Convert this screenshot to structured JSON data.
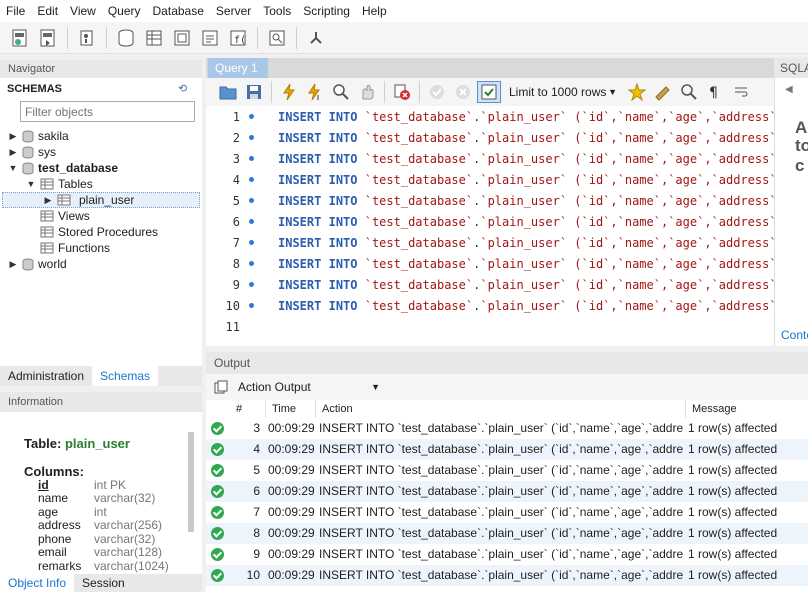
{
  "menu": [
    "File",
    "Edit",
    "View",
    "Query",
    "Database",
    "Server",
    "Tools",
    "Scripting",
    "Help"
  ],
  "navigator": {
    "title": "Navigator",
    "schemas_label": "SCHEMAS",
    "filter_placeholder": "Filter objects",
    "tree": {
      "sakila": "sakila",
      "sys": "sys",
      "test_database": "test_database",
      "tables": "Tables",
      "plain_user": "plain_user",
      "views": "Views",
      "stored_procedures": "Stored Procedures",
      "functions": "Functions",
      "world": "world"
    },
    "tabs": {
      "administration": "Administration",
      "schemas": "Schemas"
    }
  },
  "information": {
    "title": "Information",
    "table_prefix": "Table: ",
    "table_name": "plain_user",
    "columns_label": "Columns:",
    "columns": [
      {
        "name": "id",
        "type": "int PK"
      },
      {
        "name": "name",
        "type": "varchar(32)"
      },
      {
        "name": "age",
        "type": "int"
      },
      {
        "name": "address",
        "type": "varchar(256)"
      },
      {
        "name": "phone",
        "type": "varchar(32)"
      },
      {
        "name": "email",
        "type": "varchar(128)"
      },
      {
        "name": "remarks",
        "type": "varchar(1024)"
      }
    ],
    "tabs": {
      "object_info": "Object Info",
      "session": "Session"
    }
  },
  "query": {
    "tab_label": "Query 1",
    "right_tab_label": "SQLA",
    "limit_label": "Limit to 1000 rows",
    "right_panel_lines": [
      "A",
      "to",
      "c"
    ],
    "right_panel_link": "Conte",
    "lines": [
      {
        "num": "1",
        "kw1": "INSERT",
        "kw2": "INTO",
        "db": "`test_database`",
        "dot": ".",
        "tbl": "`plain_user`",
        "cols": " (`id`,`name`,`age`,`address`,`"
      },
      {
        "num": "2",
        "kw1": "INSERT",
        "kw2": "INTO",
        "db": "`test_database`",
        "dot": ".",
        "tbl": "`plain_user`",
        "cols": " (`id`,`name`,`age`,`address`,`"
      },
      {
        "num": "3",
        "kw1": "INSERT",
        "kw2": "INTO",
        "db": "`test_database`",
        "dot": ".",
        "tbl": "`plain_user`",
        "cols": " (`id`,`name`,`age`,`address`,`"
      },
      {
        "num": "4",
        "kw1": "INSERT",
        "kw2": "INTO",
        "db": "`test_database`",
        "dot": ".",
        "tbl": "`plain_user`",
        "cols": " (`id`,`name`,`age`,`address`,`"
      },
      {
        "num": "5",
        "kw1": "INSERT",
        "kw2": "INTO",
        "db": "`test_database`",
        "dot": ".",
        "tbl": "`plain_user`",
        "cols": " (`id`,`name`,`age`,`address`,`"
      },
      {
        "num": "6",
        "kw1": "INSERT",
        "kw2": "INTO",
        "db": "`test_database`",
        "dot": ".",
        "tbl": "`plain_user`",
        "cols": " (`id`,`name`,`age`,`address`,`"
      },
      {
        "num": "7",
        "kw1": "INSERT",
        "kw2": "INTO",
        "db": "`test_database`",
        "dot": ".",
        "tbl": "`plain_user`",
        "cols": " (`id`,`name`,`age`,`address`,`"
      },
      {
        "num": "8",
        "kw1": "INSERT",
        "kw2": "INTO",
        "db": "`test_database`",
        "dot": ".",
        "tbl": "`plain_user`",
        "cols": " (`id`,`name`,`age`,`address`,`"
      },
      {
        "num": "9",
        "kw1": "INSERT",
        "kw2": "INTO",
        "db": "`test_database`",
        "dot": ".",
        "tbl": "`plain_user`",
        "cols": " (`id`,`name`,`age`,`address`,`"
      },
      {
        "num": "10",
        "kw1": "INSERT",
        "kw2": "INTO",
        "db": "`test_database`",
        "dot": ".",
        "tbl": "`plain_user`",
        "cols": " (`id`,`name`,`age`,`address`,`"
      }
    ],
    "last_line_num": "11"
  },
  "output": {
    "title": "Output",
    "selector": "Action Output",
    "headers": {
      "num": "#",
      "time": "Time",
      "action": "Action",
      "message": "Message"
    },
    "rows": [
      {
        "num": "3",
        "time": "00:09:29",
        "action": "INSERT INTO `test_database`.`plain_user` (`id`,`name`,`age`,`address`,`ph...",
        "message": "1 row(s) affected"
      },
      {
        "num": "4",
        "time": "00:09:29",
        "action": "INSERT INTO `test_database`.`plain_user` (`id`,`name`,`age`,`address`,`ph...",
        "message": "1 row(s) affected"
      },
      {
        "num": "5",
        "time": "00:09:29",
        "action": "INSERT INTO `test_database`.`plain_user` (`id`,`name`,`age`,`address`,`ph...",
        "message": "1 row(s) affected"
      },
      {
        "num": "6",
        "time": "00:09:29",
        "action": "INSERT INTO `test_database`.`plain_user` (`id`,`name`,`age`,`address`,`ph...",
        "message": "1 row(s) affected"
      },
      {
        "num": "7",
        "time": "00:09:29",
        "action": "INSERT INTO `test_database`.`plain_user` (`id`,`name`,`age`,`address`,`ph...",
        "message": "1 row(s) affected"
      },
      {
        "num": "8",
        "time": "00:09:29",
        "action": "INSERT INTO `test_database`.`plain_user` (`id`,`name`,`age`,`address`,`ph...",
        "message": "1 row(s) affected"
      },
      {
        "num": "9",
        "time": "00:09:29",
        "action": "INSERT INTO `test_database`.`plain_user` (`id`,`name`,`age`,`address`,`ph...",
        "message": "1 row(s) affected"
      },
      {
        "num": "10",
        "time": "00:09:29",
        "action": "INSERT INTO `test_database`.`plain_user` (`id`,`name`,`age`,`address`,`ph...",
        "message": "1 row(s) affected"
      }
    ]
  }
}
